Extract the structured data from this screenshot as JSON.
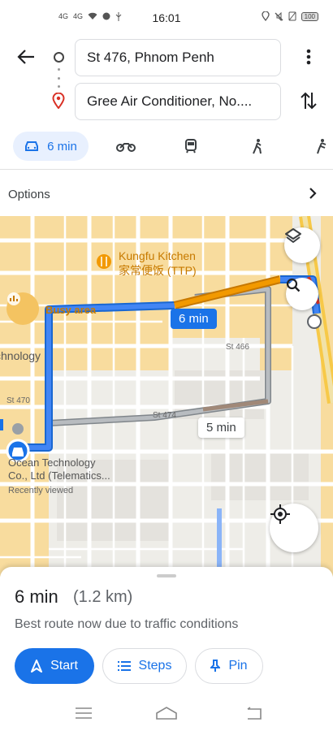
{
  "status_bar": {
    "time": "16:01",
    "left_icons": [
      "4G",
      "4G",
      "wifi-icon",
      "messenger-icon",
      "usb-icon"
    ],
    "battery": "100"
  },
  "directions": {
    "origin": "St 476, Phnom Penh",
    "destination": "Gree Air Conditioner, No...."
  },
  "travel_modes": [
    {
      "name": "car-icon",
      "label": "6 min",
      "active": true
    },
    {
      "name": "motorbike-icon",
      "label": "",
      "active": false
    },
    {
      "name": "transit-icon",
      "label": "",
      "active": false
    },
    {
      "name": "walk-icon",
      "label": "",
      "active": false
    },
    {
      "name": "ride-icon",
      "label": "",
      "active": false
    }
  ],
  "options_label": "Options",
  "map": {
    "poi_kungfu_line1": "Kungfu Kitchen",
    "poi_kungfu_line2": "家常便饭 (TTP)",
    "busy_area": "Busy area",
    "ocean_line1": "Ocean Technology",
    "ocean_line2": "Co., Ltd (Telematics...",
    "recently_viewed": "Recently viewed",
    "technology_fragment": "chnology",
    "street_st470": "St 470",
    "street_st466": "St 466",
    "street_st474": "St 474",
    "primary_route_time": "6 min",
    "alt_route_time": "5 min",
    "route_colors": {
      "primary": "#1a73e8",
      "traffic": "#f29900",
      "alt": "#9aa0a6"
    }
  },
  "sheet": {
    "duration": "6 min",
    "distance": "(1.2 km)",
    "reason": "Best route now due to traffic conditions",
    "start_label": "Start",
    "steps_label": "Steps",
    "pin_label": "Pin"
  }
}
